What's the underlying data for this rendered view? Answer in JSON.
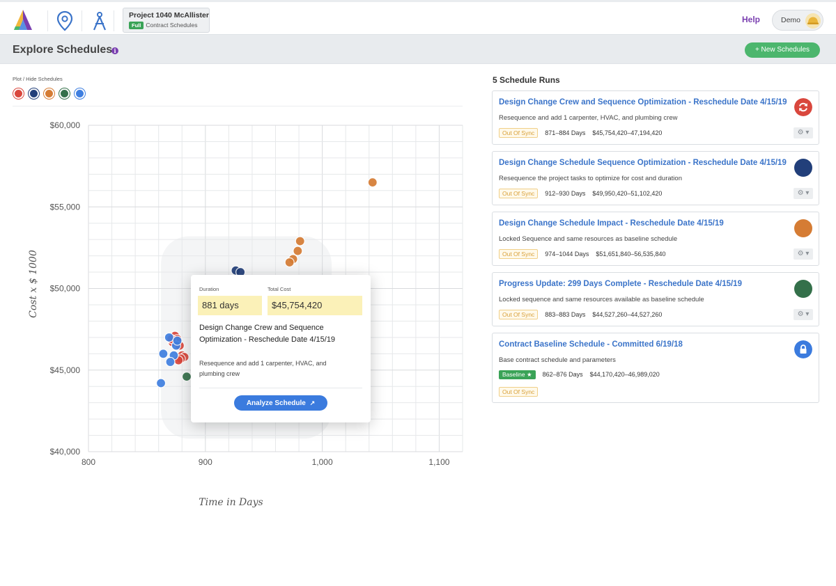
{
  "header": {
    "project_name": "Project 1040 McAllister",
    "project_badge": "Full",
    "project_sub": "Contract Schedules",
    "help": "Help",
    "user": "Demo"
  },
  "subheader": {
    "title": "Explore Schedules",
    "info_glyph": "i",
    "new_button": "+ New Schedules"
  },
  "plot_toggle": {
    "label": "Plot / Hide Schedules",
    "colors": [
      "#d9473d",
      "#223f7a",
      "#d57c34",
      "#34704a",
      "#3f7fe0"
    ]
  },
  "chart_data": {
    "type": "scatter",
    "xlabel": "Time in Days",
    "ylabel": "Cost x $ 1000",
    "xlim": [
      800,
      1120
    ],
    "ylim": [
      40000,
      60000
    ],
    "x_ticks": [
      "800",
      "900",
      "1,000",
      "1,100"
    ],
    "y_ticks": [
      "$40,000",
      "$45,000",
      "$50,000",
      "$55,000",
      "$60,000"
    ],
    "grid": true,
    "series": [
      {
        "color": "#d9473d",
        "points": [
          [
            874,
            47100
          ],
          [
            876,
            46900
          ],
          [
            872,
            46700
          ],
          [
            878,
            46500
          ],
          [
            880,
            45900
          ],
          [
            882,
            45800
          ],
          [
            879,
            45700
          ],
          [
            871,
            46900
          ],
          [
            877,
            45600
          ]
        ]
      },
      {
        "color": "#223f7a",
        "points": [
          [
            926,
            51100
          ],
          [
            930,
            51000
          ]
        ]
      },
      {
        "color": "#d57c34",
        "points": [
          [
            981,
            52900
          ],
          [
            979,
            52300
          ],
          [
            975,
            51800
          ],
          [
            972,
            51600
          ],
          [
            1043,
            56500
          ]
        ]
      },
      {
        "color": "#34704a",
        "points": [
          [
            884,
            44600
          ]
        ]
      },
      {
        "color": "#3f7fe0",
        "points": [
          [
            869,
            47000
          ],
          [
            875,
            46500
          ],
          [
            864,
            46000
          ],
          [
            873,
            45900
          ],
          [
            870,
            45500
          ],
          [
            876,
            46800
          ],
          [
            862,
            44200
          ]
        ]
      }
    ]
  },
  "tooltip": {
    "duration_label": "Duration",
    "duration_value": "881 days",
    "cost_label": "Total Cost",
    "cost_value": "$45,754,420",
    "title": "Design Change Crew and Sequence Optimization - Reschedule Date 4/15/19",
    "description": "Resequence and add 1 carpenter, HVAC, and plumbing crew",
    "button": "Analyze Schedule"
  },
  "runs": {
    "heading": "5 Schedule Runs",
    "items": [
      {
        "title": "Design Change Crew and Sequence Optimization - Reschedule Date 4/15/19",
        "desc": "Resequence and add 1 carpenter, HVAC, and plumbing crew",
        "status": "Out Of Sync",
        "days": "871–884 Days",
        "cost": "$45,754,420–47,194,420",
        "color": "#d9473d",
        "icon": "refresh-icon"
      },
      {
        "title": "Design Change Schedule Sequence Optimization - Reschedule Date 4/15/19",
        "desc": "Resequence the project tasks to optimize for cost and duration",
        "status": "Out Of Sync",
        "days": "912–930 Days",
        "cost": "$49,950,420–51,102,420",
        "color": "#223f7a",
        "icon": "dot-icon"
      },
      {
        "title": "Design Change Schedule Impact - Reschedule Date 4/15/19",
        "desc": "Locked Sequence and same resources as baseline schedule",
        "status": "Out Of Sync",
        "days": "974–1044 Days",
        "cost": "$51,651,840–56,535,840",
        "color": "#d57c34",
        "icon": "dot-icon"
      },
      {
        "title": "Progress Update: 299 Days Complete - Reschedule Date 4/15/19",
        "desc": "Locked sequence and same resources available as baseline schedule",
        "status": "Out Of Sync",
        "days": "883–883 Days",
        "cost": "$44,527,260–44,527,260",
        "color": "#34704a",
        "icon": "dot-icon"
      },
      {
        "title": "Contract Baseline Schedule - Committed 6/19/18",
        "desc": "Base contract schedule and parameters",
        "status": "Out Of Sync",
        "baseline": "Baseline ★",
        "days": "862–876 Days",
        "cost": "$44,170,420–46,989,020",
        "color": "#3f7fe0",
        "icon": "lock-icon"
      }
    ]
  }
}
